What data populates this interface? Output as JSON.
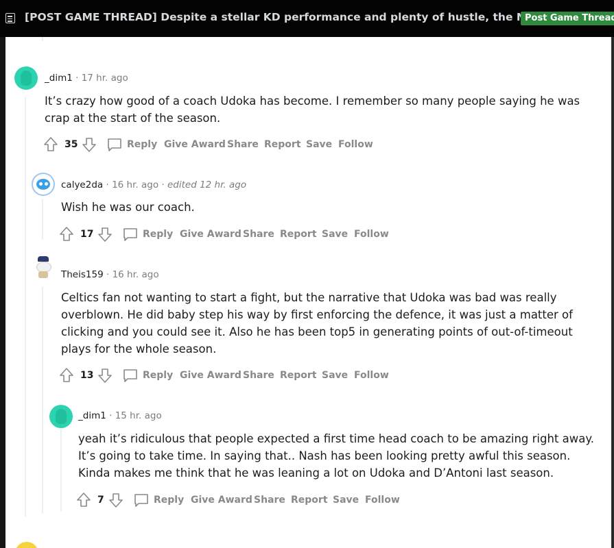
{
  "header": {
    "title": "[POST GAME THREAD] Despite a stellar KD performance and plenty of hustle, the Nets can'...",
    "flair": "Post Game Thread",
    "flair_color": "#2f8a3e"
  },
  "actions": {
    "reply": "Reply",
    "give_award": "Give Award",
    "share": "Share",
    "report": "Report",
    "save": "Save",
    "follow": "Follow"
  },
  "comments": [
    {
      "username": "_dim1",
      "age": "17 hr. ago",
      "avatar": "teal-snoo-avatar",
      "body": [
        "It’s crazy how good of a coach Udoka has become. I remember so many people saying he was crap at the start of the season."
      ],
      "votes": "35"
    },
    {
      "username": "calye2da",
      "age": "16 hr. ago",
      "edited": "edited 12 hr. ago",
      "avatar": "blue-snoo-avatar",
      "body": [
        "Wish he was our coach."
      ],
      "votes": "17"
    },
    {
      "username": "Theis159",
      "age": "16 hr. ago",
      "avatar": "police-snoo-avatar",
      "body": [
        "Celtics fan not wanting to start a fight, but the narrative that Udoka was bad was really overblown. He did baby step his way by first enforcing the defence, it was just a matter of clicking and you could see it. Also he has been top5 in generating points of out-of-timeout plays for the whole season."
      ],
      "votes": "13"
    },
    {
      "username": "_dim1",
      "age": "15 hr. ago",
      "avatar": "teal-snoo-avatar",
      "body": [
        "yeah it’s ridiculous that people expected a first time head coach to be amazing right away. It’s going to take time. In saying that.. Nash has been looking pretty awful this season. Kinda makes me think that he was leaning a lot on Udoka and D’Antoni last season."
      ],
      "votes": "7"
    }
  ]
}
